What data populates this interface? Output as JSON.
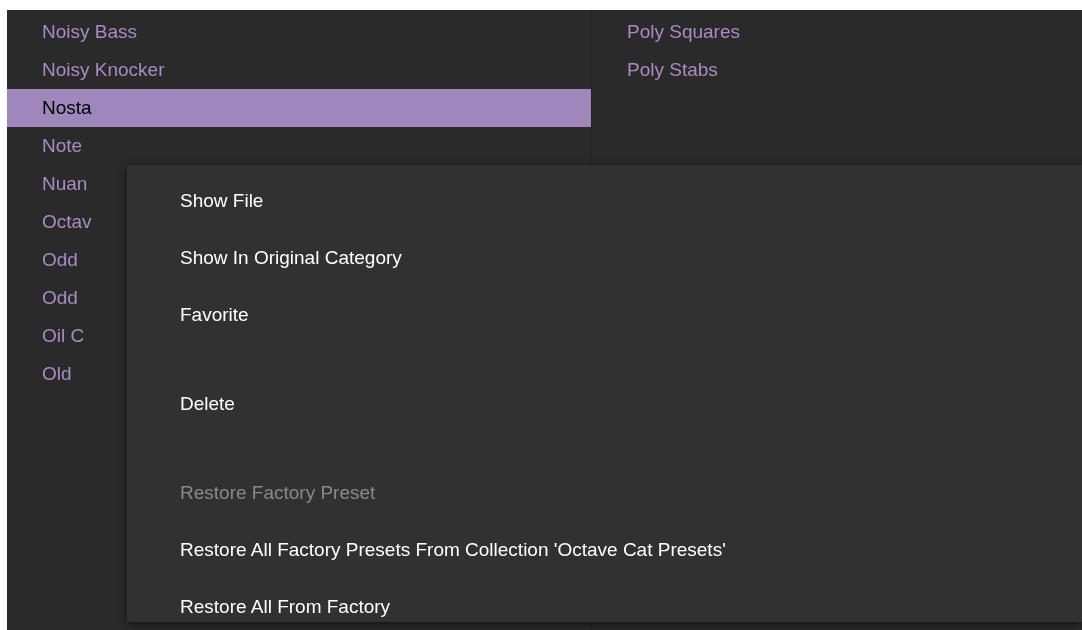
{
  "preset_list": {
    "left_column": [
      {
        "name": "Noisy Bass",
        "selected": false
      },
      {
        "name": "Noisy Knocker",
        "selected": false
      },
      {
        "name": "Nosta",
        "selected": true
      },
      {
        "name": "Note",
        "selected": false
      },
      {
        "name": "Nuan",
        "selected": false
      },
      {
        "name": "Octav",
        "selected": false
      },
      {
        "name": "Odd",
        "selected": false
      },
      {
        "name": "Odd",
        "selected": false
      },
      {
        "name": "Oil C",
        "selected": false
      },
      {
        "name": "Old",
        "selected": false
      }
    ],
    "right_column": [
      {
        "name": "Poly Squares",
        "selected": false
      },
      {
        "name": "Poly Stabs",
        "selected": false
      }
    ]
  },
  "context_menu": {
    "items": [
      {
        "kind": "item",
        "label": "Show File",
        "disabled": false
      },
      {
        "kind": "item",
        "label": "Show In Original Category",
        "disabled": false
      },
      {
        "kind": "item",
        "label": "Favorite",
        "disabled": false
      },
      {
        "kind": "separator"
      },
      {
        "kind": "item",
        "label": "Delete",
        "disabled": false
      },
      {
        "kind": "separator"
      },
      {
        "kind": "item",
        "label": "Restore Factory Preset",
        "disabled": true
      },
      {
        "kind": "item",
        "label": "Restore All Factory Presets From Collection 'Octave Cat Presets'",
        "disabled": false
      },
      {
        "kind": "item",
        "label": "Restore All From Factory",
        "disabled": false
      }
    ]
  }
}
